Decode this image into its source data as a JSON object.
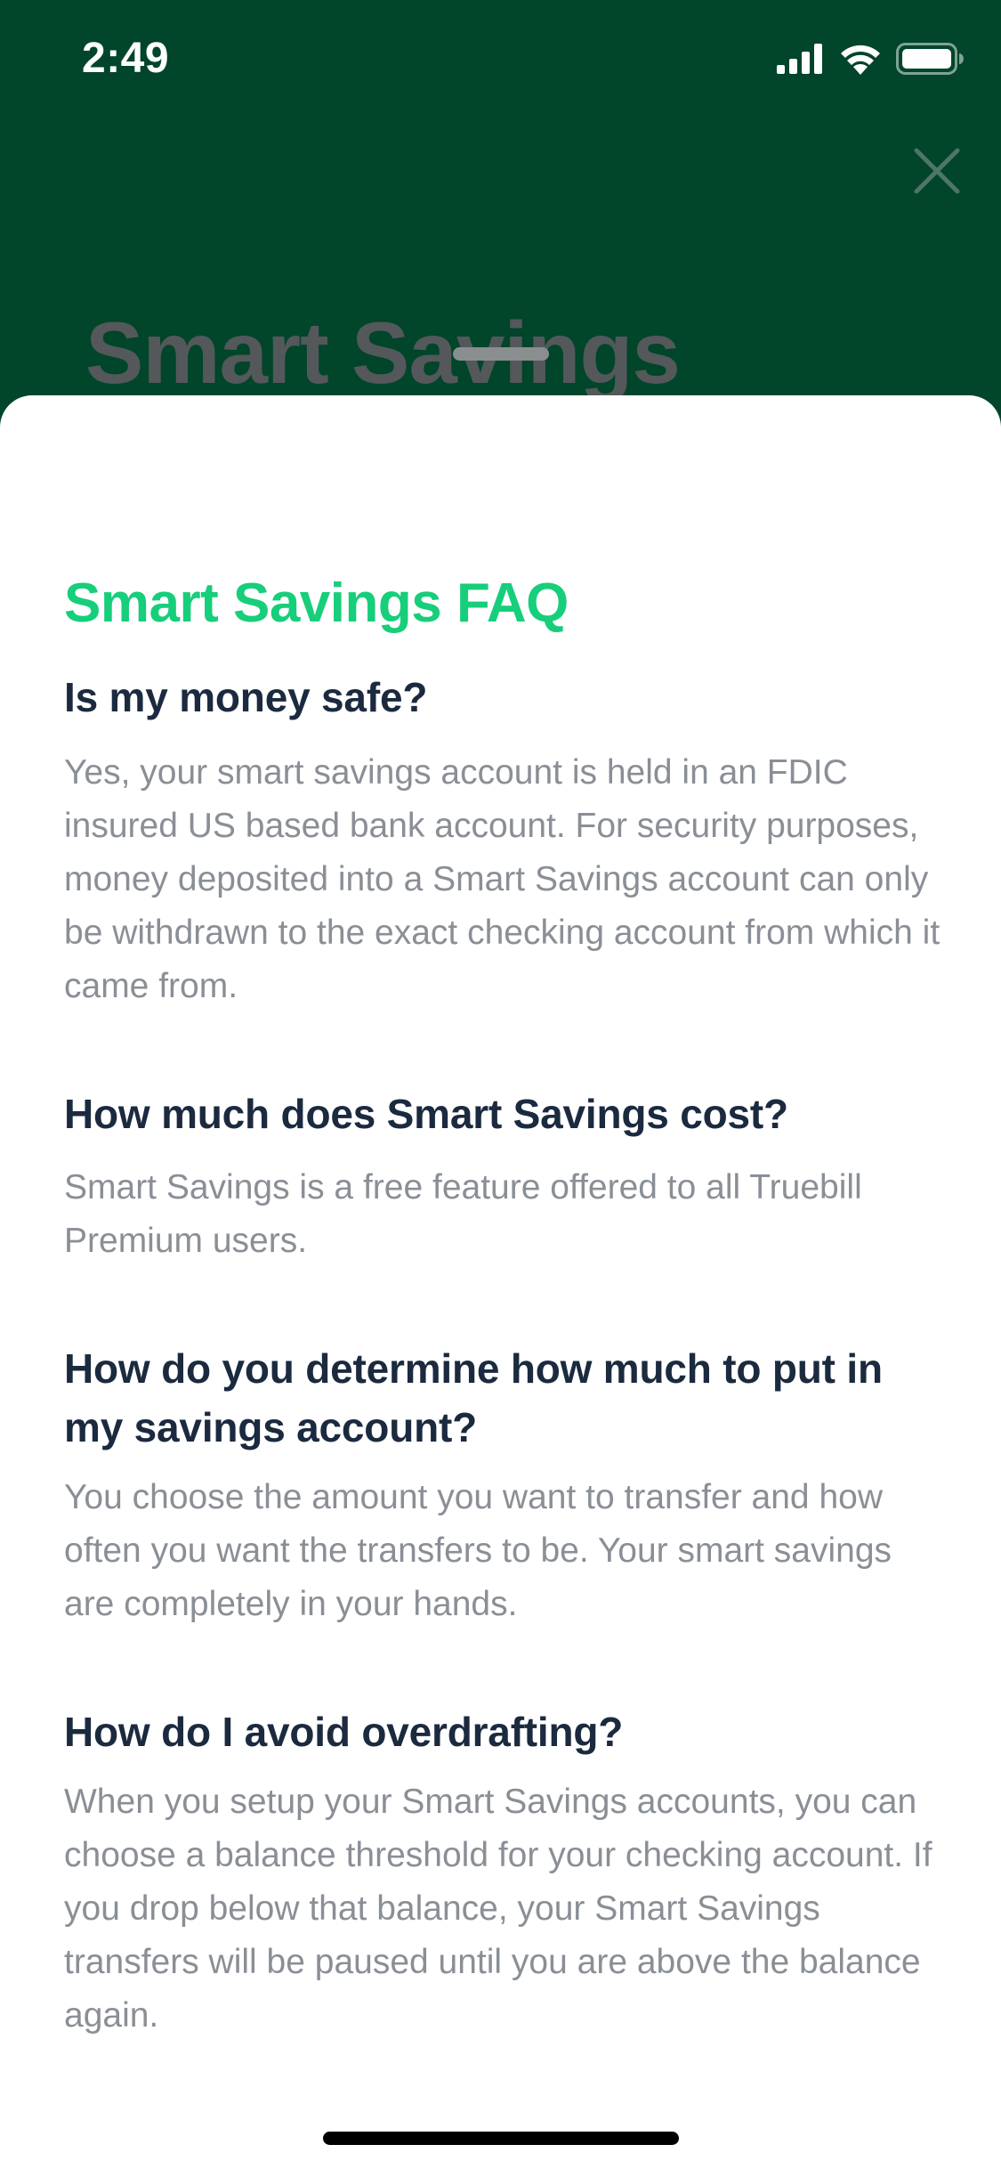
{
  "status_bar": {
    "time": "2:49"
  },
  "background": {
    "title": "Smart Savings"
  },
  "faq": {
    "title": "Smart Savings FAQ",
    "items": [
      {
        "question": "Is my money safe?",
        "answer": "Yes, your smart savings account is held in an FDIC insured US based bank account. For security purposes, money deposited into a Smart Savings account can only be withdrawn to the exact checking account from which it came from."
      },
      {
        "question": "How much does Smart Savings cost?",
        "answer": "Smart Savings is a free feature offered to all Truebill Premium users."
      },
      {
        "question": "How do you determine how much to put in my savings account?",
        "answer": "You choose the amount you want to transfer and how often you want the transfers to be. Your smart savings are completely in your hands."
      },
      {
        "question": "How do I avoid overdrafting?",
        "answer": "When you setup your Smart Savings accounts, you can choose a balance threshold for your checking account. If you drop below that balance, your Smart Savings transfers will be paused until you are above the balance again."
      }
    ]
  },
  "icons": {
    "signal": "cellular-signal-icon",
    "wifi": "wifi-icon",
    "battery": "battery-icon",
    "close": "close-icon"
  },
  "colors": {
    "header_background": "#01452B",
    "faq_title": "#17CE7B",
    "question_text": "#1B2A3F",
    "answer_text": "#8A8F96"
  }
}
